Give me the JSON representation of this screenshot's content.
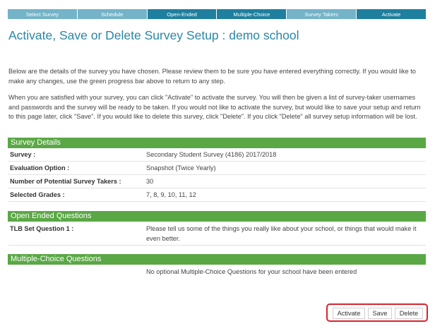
{
  "progress": {
    "steps": [
      {
        "label": "Select Survey"
      },
      {
        "label": "Schedule"
      },
      {
        "label": "Open-Ended"
      },
      {
        "label": "Multiple-Choice"
      },
      {
        "label": "Survey Takers"
      },
      {
        "label": "Activate"
      }
    ]
  },
  "page_title": "Activate, Save or Delete Survey Setup : demo school",
  "intro": {
    "paragraph1": "Below are the details of the survey you have chosen. Please review them to be sure you have entered everything correctly. If you would like to make any changes, use the green progress bar above to return to any step.",
    "paragraph2": "When you are satisfied with your survey, you can click \"Activate\" to activate the survey. You will then be given a list of survey-taker usernames and passwords and the survey will be ready to be taken. If you would not like to activate the survey, but would like to save your setup and return to this page later, click \"Save\". If you would like to delete this survey, click \"Delete\". If you click \"Delete\" all survey setup information will be lost."
  },
  "survey_details": {
    "header": "Survey Details",
    "rows": [
      {
        "label": "Survey :",
        "value": "Secondary Student Survey (4186) 2017/2018"
      },
      {
        "label": "Evaluation Option :",
        "value": "Snapshot (Twice Yearly)"
      },
      {
        "label": "Number of Potential Survey Takers :",
        "value": "30"
      },
      {
        "label": "Selected Grades :",
        "value": "7, 8, 9, 10, 11, 12"
      }
    ]
  },
  "open_ended": {
    "header": "Open Ended Questions",
    "rows": [
      {
        "label": "TLB Set Question 1 :",
        "value": "Please tell us some of the things you really like about your school, or things that would make it even better."
      }
    ]
  },
  "multiple_choice": {
    "header": "Multiple-Choice Questions",
    "message": "No optional Multiple-Choice Questions for your school have been entered"
  },
  "actions": {
    "activate": "Activate",
    "save": "Save",
    "delete": "Delete"
  },
  "colors": {
    "step_light": "#74b3c8",
    "step_dark": "#1f7f9e",
    "title": "#2a86a5",
    "section_green": "#5aa845",
    "highlight_red": "#d9232d"
  }
}
